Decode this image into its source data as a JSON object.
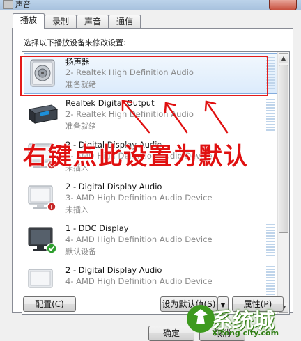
{
  "window": {
    "title": "声音"
  },
  "tabs": [
    {
      "label": "播放"
    },
    {
      "label": "录制"
    },
    {
      "label": "声音"
    },
    {
      "label": "通信"
    }
  ],
  "instruction": "选择以下播放设备来修改设置:",
  "devices": [
    {
      "name": "扬声器",
      "driver": "2- Realtek High Definition Audio",
      "status": "准备就绪",
      "icon": "speaker-icon"
    },
    {
      "name": "Realtek Digital Output",
      "driver": "2- Realtek High Definition Audio",
      "status": "准备就绪",
      "icon": "digital-output-icon"
    },
    {
      "name": "2 - Digital Display Audio",
      "driver": "3- AMD High Definition Audio Device",
      "status": "未插入",
      "icon": "monitor-unplugged-icon"
    },
    {
      "name": "2 - Digital Display Audio",
      "driver": "3- AMD High Definition Audio Device",
      "status": "未插入",
      "icon": "monitor-unplugged-icon"
    },
    {
      "name": "1 - DDC Display",
      "driver": "4- AMD High Definition Audio Device",
      "status": "默认设备",
      "icon": "monitor-default-icon"
    },
    {
      "name": "2 - Digital Display Audio",
      "driver": "4- AMD High Definition Audio Device",
      "status": "",
      "icon": "monitor-icon"
    }
  ],
  "buttons": {
    "configure": "配置(C)",
    "set_default": "设为默认值(S)",
    "properties": "属性(P)",
    "ok": "确定",
    "cancel": "取消"
  },
  "annotation": "右键点此设置为默认",
  "watermark": {
    "text": "系统城",
    "url": "Xitong city.com"
  },
  "colors": {
    "annotation": "#e01010",
    "selection": "#dcebfc"
  }
}
